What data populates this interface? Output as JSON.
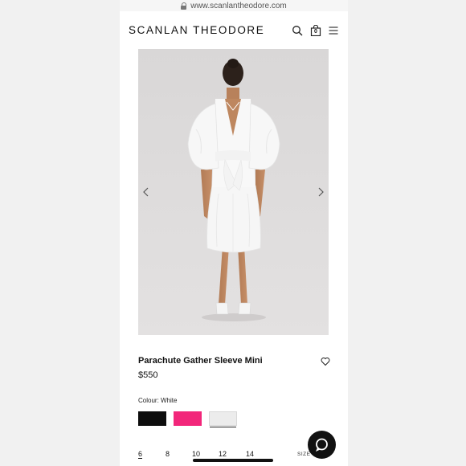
{
  "browser": {
    "url": "www.scanlantheodore.com",
    "lock_icon": "lock-icon"
  },
  "header": {
    "brand": "SCANLAN THEODORE",
    "icons": [
      "search-icon",
      "bag-icon",
      "menu-icon"
    ],
    "bag_count": "0"
  },
  "gallery": {
    "prev_icon": "chevron-left-icon",
    "next_icon": "chevron-right-icon",
    "image": "model back view white dress"
  },
  "product": {
    "name": "Parachute Gather Sleeve Mini",
    "price": "$550",
    "wishlist_icon": "heart-icon"
  },
  "colour": {
    "label": "Colour: White",
    "swatches": [
      {
        "name": "black",
        "color": "#0d0d0d",
        "selected": false
      },
      {
        "name": "pink",
        "color": "#f2267a",
        "selected": false
      },
      {
        "name": "white",
        "color": "#ececec",
        "selected": true
      }
    ]
  },
  "sizes": {
    "options": [
      "6",
      "8",
      "10",
      "12",
      "14"
    ],
    "selected": "6",
    "guide_label": "SIZE G"
  },
  "chat": {
    "icon": "chat-icon"
  }
}
